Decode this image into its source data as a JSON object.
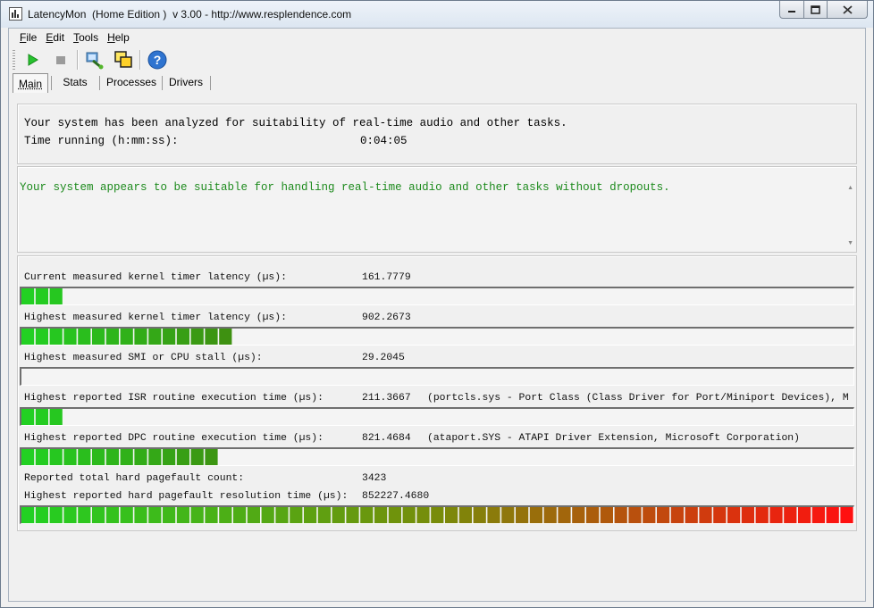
{
  "window": {
    "title": "LatencyMon  (Home Edition )  v 3.00 - http://www.resplendence.com"
  },
  "menu": [
    {
      "pre": "",
      "ul": "F",
      "post": "ile"
    },
    {
      "pre": "",
      "ul": "E",
      "post": "dit"
    },
    {
      "pre": "",
      "ul": "T",
      "post": "ools"
    },
    {
      "pre": "",
      "ul": "H",
      "post": "elp"
    }
  ],
  "toolbar": {
    "icons": [
      "play-icon",
      "stop-icon",
      "analyze-icon",
      "windows-icon",
      "help-icon"
    ]
  },
  "tabs": [
    "Main",
    "Stats",
    "Processes",
    "Drivers"
  ],
  "summary": {
    "line1": "Your system has been analyzed for suitability of real-time audio and other tasks.",
    "time_label": "Time running (h:mm:ss):",
    "time_value": "0:04:05"
  },
  "verdict": {
    "text": "Your system appears to be suitable for handling real-time audio and other tasks without dropouts.",
    "color": "#1c8a1c"
  },
  "metrics": [
    {
      "label": "Current measured kernel timer latency (µs):",
      "value": "161.7779",
      "extra": "",
      "segments": 3
    },
    {
      "label": "Highest measured kernel timer latency (µs):",
      "value": "902.2673",
      "extra": "",
      "segments": 15
    },
    {
      "label": "Highest measured SMI or CPU stall (µs):",
      "value": "29.2045",
      "extra": "",
      "segments": 0
    },
    {
      "label": "Highest reported ISR routine execution time (µs):",
      "value": "211.3667",
      "extra": "(portcls.sys - Port Class (Class Driver for Port/Miniport Devices), M",
      "segments": 3
    },
    {
      "label": "Highest reported DPC routine execution time (µs):",
      "value": "821.4684",
      "extra": "(ataport.SYS - ATAPI Driver Extension, Microsoft Corporation)",
      "segments": 14
    }
  ],
  "pagefault": {
    "count_label": "Reported total hard pagefault count:",
    "count_value": "3423",
    "time_label": "Highest reported hard pagefault resolution time (µs):",
    "time_value": "852227.4680",
    "segments": 59
  },
  "colors": {
    "bar_green": "#22d022",
    "bar_dark_green": "#3f8f10",
    "bar_red": "#ff1010"
  }
}
